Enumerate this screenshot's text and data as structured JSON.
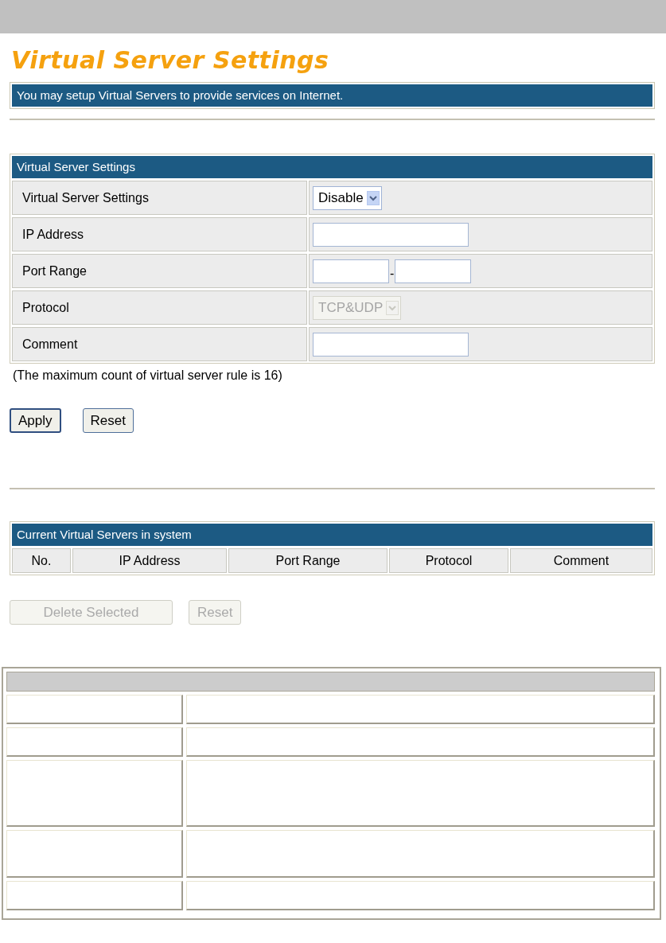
{
  "page_title": "Virtual Server Settings",
  "banner": "You may setup Virtual Servers to provide services on Internet.",
  "settings": {
    "header": "Virtual Server Settings",
    "rows": [
      {
        "label": "Virtual Server Settings",
        "kind": "select",
        "value": "Disable",
        "disabled": false
      },
      {
        "label": "IP Address",
        "kind": "input"
      },
      {
        "label": "Port Range",
        "kind": "range",
        "separator": "-"
      },
      {
        "label": "Protocol",
        "kind": "select",
        "value": "TCP&UDP",
        "disabled": true
      },
      {
        "label": "Comment",
        "kind": "input"
      }
    ]
  },
  "note": "(The maximum count of virtual server rule is 16)",
  "buttons": [
    {
      "label": "Apply",
      "disabled": false
    },
    {
      "label": "Reset",
      "disabled": false
    }
  ],
  "servers": {
    "header": "Current Virtual Servers in system",
    "columns": [
      "No.",
      "IP Address",
      "Port Range",
      "Protocol",
      "Comment"
    ]
  },
  "list_buttons": [
    {
      "label": "Delete Selected",
      "disabled": true
    },
    {
      "label": "Reset",
      "disabled": true
    }
  ]
}
